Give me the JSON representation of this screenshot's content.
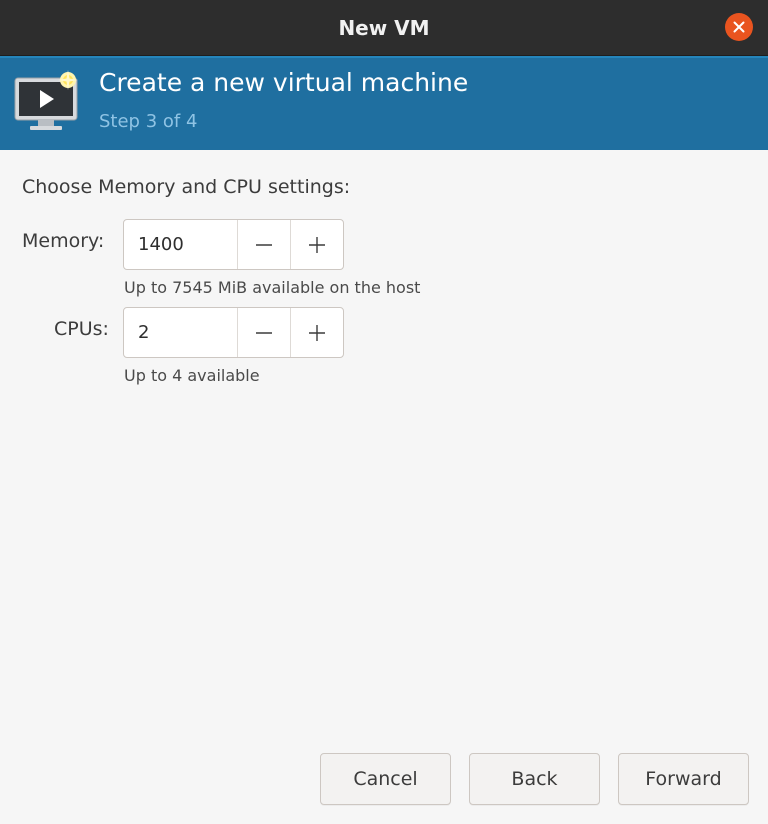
{
  "window": {
    "title": "New VM"
  },
  "banner": {
    "title": "Create a new virtual machine",
    "step": "Step 3 of 4",
    "icon": "vm-monitor-icon",
    "background": "#1f6fa0"
  },
  "settings": {
    "heading": "Choose Memory and CPU settings:",
    "memory": {
      "label": "Memory:",
      "value": "1400",
      "hint": "Up to 7545 MiB available on the host"
    },
    "cpus": {
      "label": "CPUs:",
      "value": "2",
      "hint": "Up to 4 available"
    }
  },
  "buttons": {
    "cancel": "Cancel",
    "back": "Back",
    "forward": "Forward"
  },
  "colors": {
    "titlebar": "#2d2d2d",
    "close": "#e9541f",
    "accent": "#1f6fa0"
  }
}
